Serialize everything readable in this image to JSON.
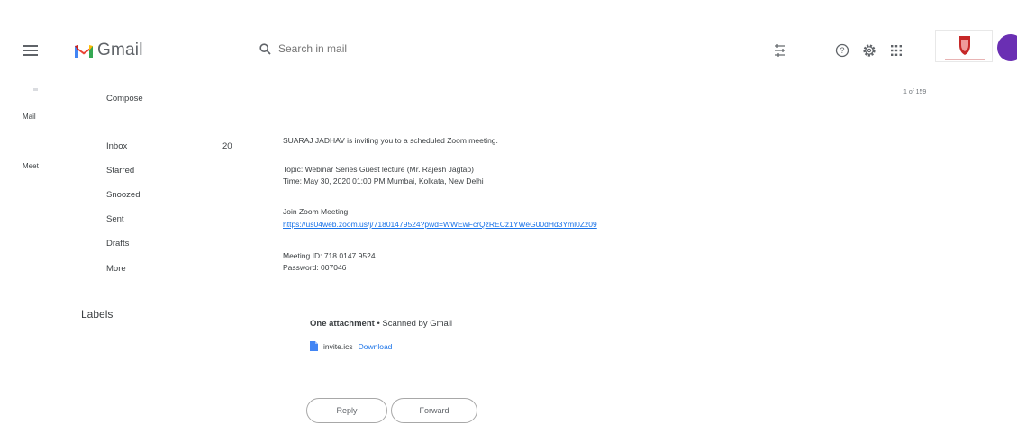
{
  "header": {
    "app_name": "Gmail",
    "search_placeholder": "Search in mail"
  },
  "rail": {
    "items": [
      {
        "label": "Mail"
      },
      {
        "label": "Meet"
      }
    ]
  },
  "sidebar": {
    "compose_label": "Compose",
    "items": [
      {
        "label": "Inbox",
        "count": "20"
      },
      {
        "label": "Starred"
      },
      {
        "label": "Snoozed"
      },
      {
        "label": "Sent"
      },
      {
        "label": "Drafts"
      },
      {
        "label": "More"
      }
    ],
    "labels_heading": "Labels"
  },
  "pager": "1 of 159",
  "message": {
    "line1": "SUARAJ JADHAV is inviting you to a scheduled Zoom meeting.",
    "topic": "Topic: Webinar Series Guest lecture (Mr. Rajesh Jagtap)",
    "time": "Time: May 30, 2020 01:00 PM Mumbai, Kolkata, New Delhi",
    "join_label": "Join Zoom Meeting",
    "join_link": "https://us04web.zoom.us/j/71801479524?pwd=WWEwFcrQzRECz1YWeG00dHd3Yml0Zz09",
    "meeting_id": "Meeting ID: 718 0147 9524",
    "password": "Password: 007046"
  },
  "attachments": {
    "heading": "One attachment",
    "scanned": "Scanned by Gmail",
    "file_name": "invite.ics",
    "download_label": "Download"
  },
  "actions": {
    "reply_label": "Reply",
    "forward_label": "Forward"
  },
  "colors": {
    "link": "#1a73e8",
    "gmail_red": "#ea4335",
    "avatar_purple": "#6a2fb3"
  }
}
